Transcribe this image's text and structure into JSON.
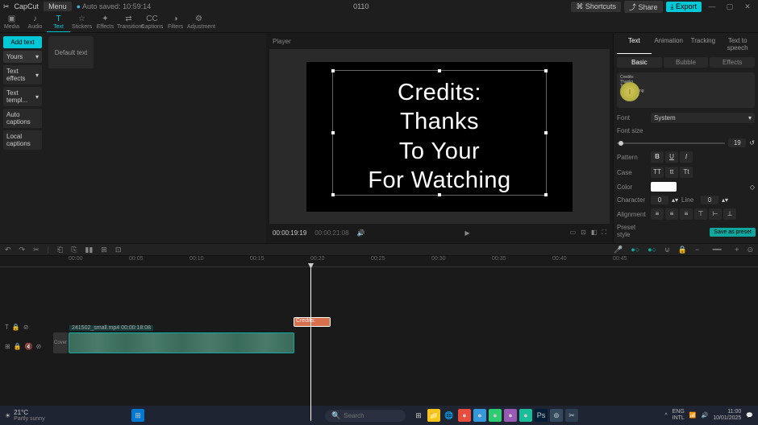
{
  "app": {
    "name": "CapCut",
    "menu": "Menu",
    "autosave": "Auto saved: 10:59:14",
    "project": "0110"
  },
  "window_buttons": {
    "shortcuts": "Shortcuts",
    "share": "Share",
    "export": "Export"
  },
  "top_tabs": [
    "Media",
    "Audio",
    "Text",
    "Stickers",
    "Effects",
    "Transitions",
    "Captions",
    "Filters",
    "Adjustment"
  ],
  "top_tab_icons": [
    "▣",
    "♪",
    "T",
    "☆",
    "✦",
    "⇄",
    "CC",
    "◑",
    "⚙"
  ],
  "side": {
    "add": "Add text",
    "items": [
      "Yours",
      "Text effects",
      "Text templ...",
      "Auto captions",
      "Local captions"
    ],
    "tile": "Default text"
  },
  "player": {
    "title": "Player",
    "text_lines": [
      "Credits:",
      "Thanks",
      "To Your",
      "For Watching"
    ],
    "time_current": "00:00:19:19",
    "time_total": "00:00:21:08"
  },
  "right": {
    "tabs": [
      "Text",
      "Animation",
      "Tracking",
      "Text to speech"
    ],
    "subtabs": [
      "Basic",
      "Bubble",
      "Effects"
    ],
    "preview_lines": [
      "Credits:",
      "Thanks",
      "To Your",
      "For Watching"
    ],
    "font_label": "Font",
    "font_value": "System",
    "size_label": "Font size",
    "size_value": "19",
    "pattern_label": "Pattern",
    "case_label": "Case",
    "color_label": "Color",
    "char_label": "Character",
    "char_value": "0",
    "line_label": "Line",
    "line_value": "0",
    "align_label": "Alignment",
    "preset_label": "Preset style",
    "save_preset": "Save as preset"
  },
  "timeline": {
    "marks": [
      "00:00",
      "00:05",
      "00:10",
      "00:15",
      "00:20",
      "00:25",
      "00:30",
      "00:35",
      "00:40",
      "00:45"
    ],
    "text_clip": "Credits:",
    "video_clip": "241502_small.mp4  00:00:18:08",
    "cover": "Cover"
  },
  "taskbar": {
    "temp": "21°C",
    "weather": "Partly sunny",
    "search_placeholder": "Search",
    "lang1": "ENG",
    "lang2": "INTL",
    "time": "11:00",
    "date": "10/01/2025"
  }
}
